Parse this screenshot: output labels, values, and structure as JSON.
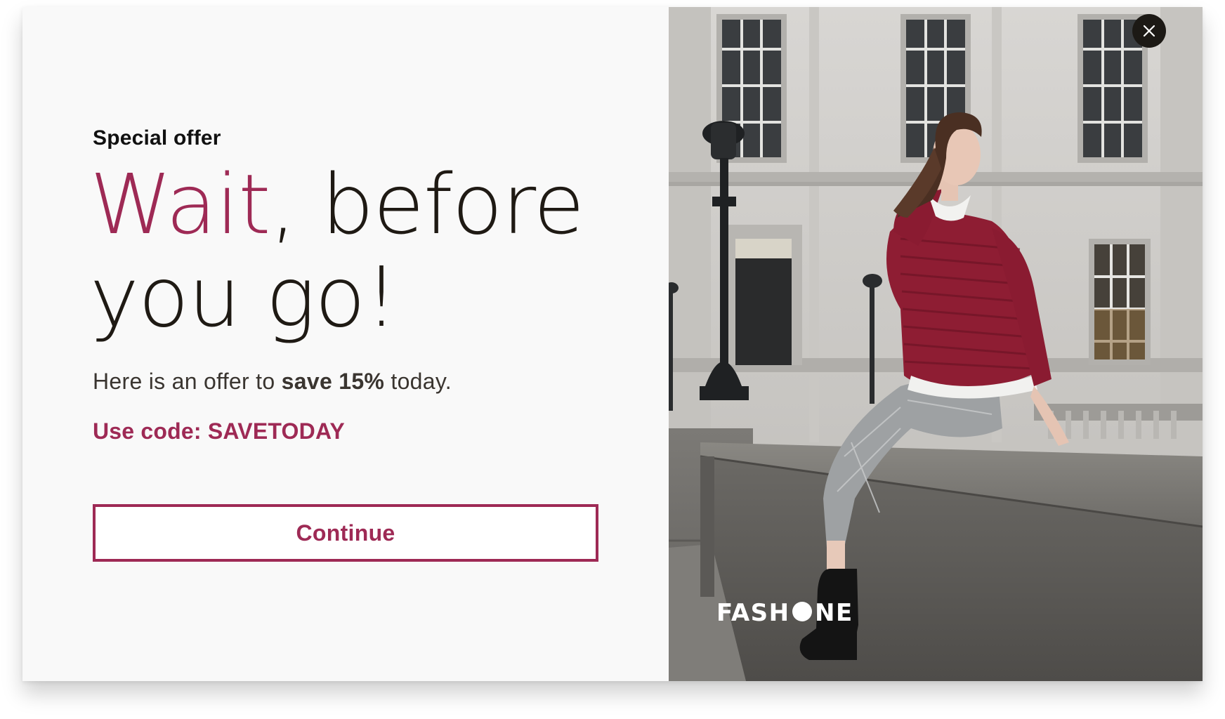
{
  "popup": {
    "eyebrow": "Special offer",
    "headline": {
      "accent": "Wait",
      "rest_line1": ", before",
      "line2": "you go!"
    },
    "offer": {
      "prefix": "Here is an offer to ",
      "highlight": "save 15%",
      "suffix": " today."
    },
    "code_label": "Use code: SAVETODAY",
    "continue_label": "Continue",
    "close_icon": "close-icon",
    "brand_logo_text": "FASHONE"
  },
  "colors": {
    "accent": "#9e2a55",
    "text_dark": "#1f1a14",
    "panel_bg": "#f9f9f9",
    "close_bg": "#1c1915"
  }
}
